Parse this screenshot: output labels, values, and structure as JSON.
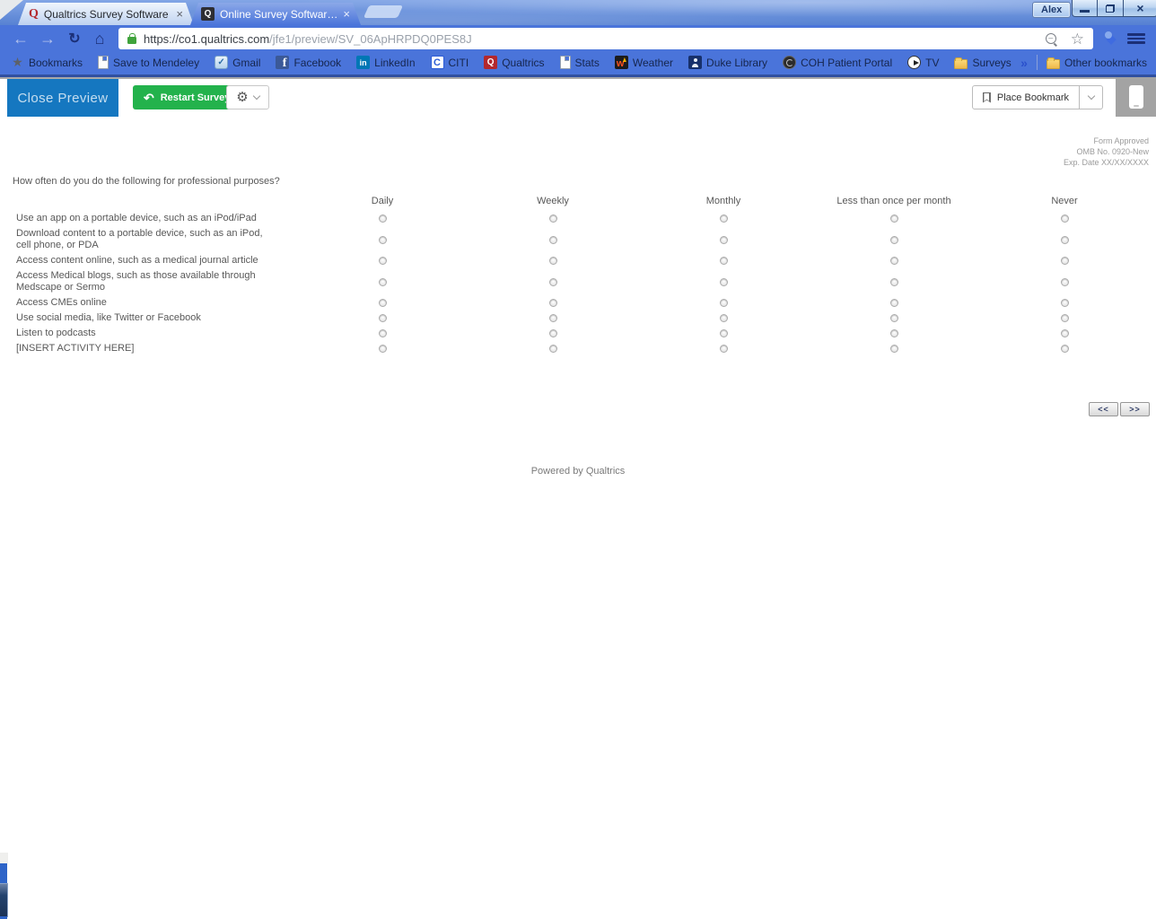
{
  "browser": {
    "profile_name": "Alex",
    "window_controls": {
      "close": "×"
    },
    "tabs": [
      {
        "title": "Qualtrics Survey Software",
        "favicon": "qualtrics-red-q",
        "close": "×",
        "active": false
      },
      {
        "title": "Online Survey Software | C",
        "favicon": "qualtrics-dark-q",
        "close": "×",
        "active": true
      }
    ],
    "nav_icons": {
      "back": "←",
      "forward": "→",
      "reload": "↻",
      "home": "⌂"
    },
    "omnibox": {
      "url_host": "https://co1.qualtrics.com",
      "url_path": "/jfe1/preview/SV_06ApHRPDQ0PES8J",
      "star_icon": "☆"
    },
    "extension_icon": "◆",
    "bookmarks": [
      {
        "label": "Bookmarks",
        "icon": "star"
      },
      {
        "label": "Save to Mendeley",
        "icon": "page"
      },
      {
        "label": "Gmail",
        "icon": "gmail"
      },
      {
        "label": "Facebook",
        "icon": "facebook"
      },
      {
        "label": "LinkedIn",
        "icon": "linkedin"
      },
      {
        "label": "CITI",
        "icon": "citi"
      },
      {
        "label": "Qualtrics",
        "icon": "qualtrics"
      },
      {
        "label": "Stats",
        "icon": "page"
      },
      {
        "label": "Weather",
        "icon": "weather"
      },
      {
        "label": "Duke Library",
        "icon": "duke"
      },
      {
        "label": "COH Patient Portal",
        "icon": "coh"
      },
      {
        "label": "TV",
        "icon": "tv"
      },
      {
        "label": "Surveys",
        "icon": "folder"
      }
    ],
    "bookmarks_overflow": "»",
    "other_bookmarks": {
      "label": "Other bookmarks",
      "icon": "folder"
    }
  },
  "preview_bar": {
    "close_preview_label": "Close Preview",
    "restart_label": "Restart Survey",
    "restart_icon": "↶",
    "gear_icon": "⚙",
    "place_bookmark_label": "Place Bookmark"
  },
  "survey": {
    "approval": {
      "line1": "Form Approved",
      "line2": "OMB No. 0920-New",
      "line3": "Exp. Date XX/XX/XXXX"
    },
    "question": "How often do you do the following for professional purposes?",
    "matrix": {
      "columns": [
        "Daily",
        "Weekly",
        "Monthly",
        "Less than once per month",
        "Never"
      ],
      "rows": [
        "Use an app on a portable device, such as an iPod/iPad",
        "Download content to a portable device, such as an iPod, cell phone, or PDA",
        "Access content online, such as a medical journal article",
        "Access Medical blogs, such as those available through Medscape or Sermo",
        "Access CMEs online",
        "Use social media, like Twitter or Facebook",
        "Listen to podcasts",
        "[INSERT ACTIVITY HERE]"
      ],
      "selected": null
    },
    "nav": {
      "prev": "<<",
      "next": ">>"
    },
    "footer": "Powered by Qualtrics"
  },
  "colors": {
    "chrome_blue": "#4a74da",
    "frame_blue": "#6f97e0",
    "qualtrics_blue": "#1577c0",
    "restart_green": "#23b24c",
    "panel_gray": "#a3a3a3"
  }
}
